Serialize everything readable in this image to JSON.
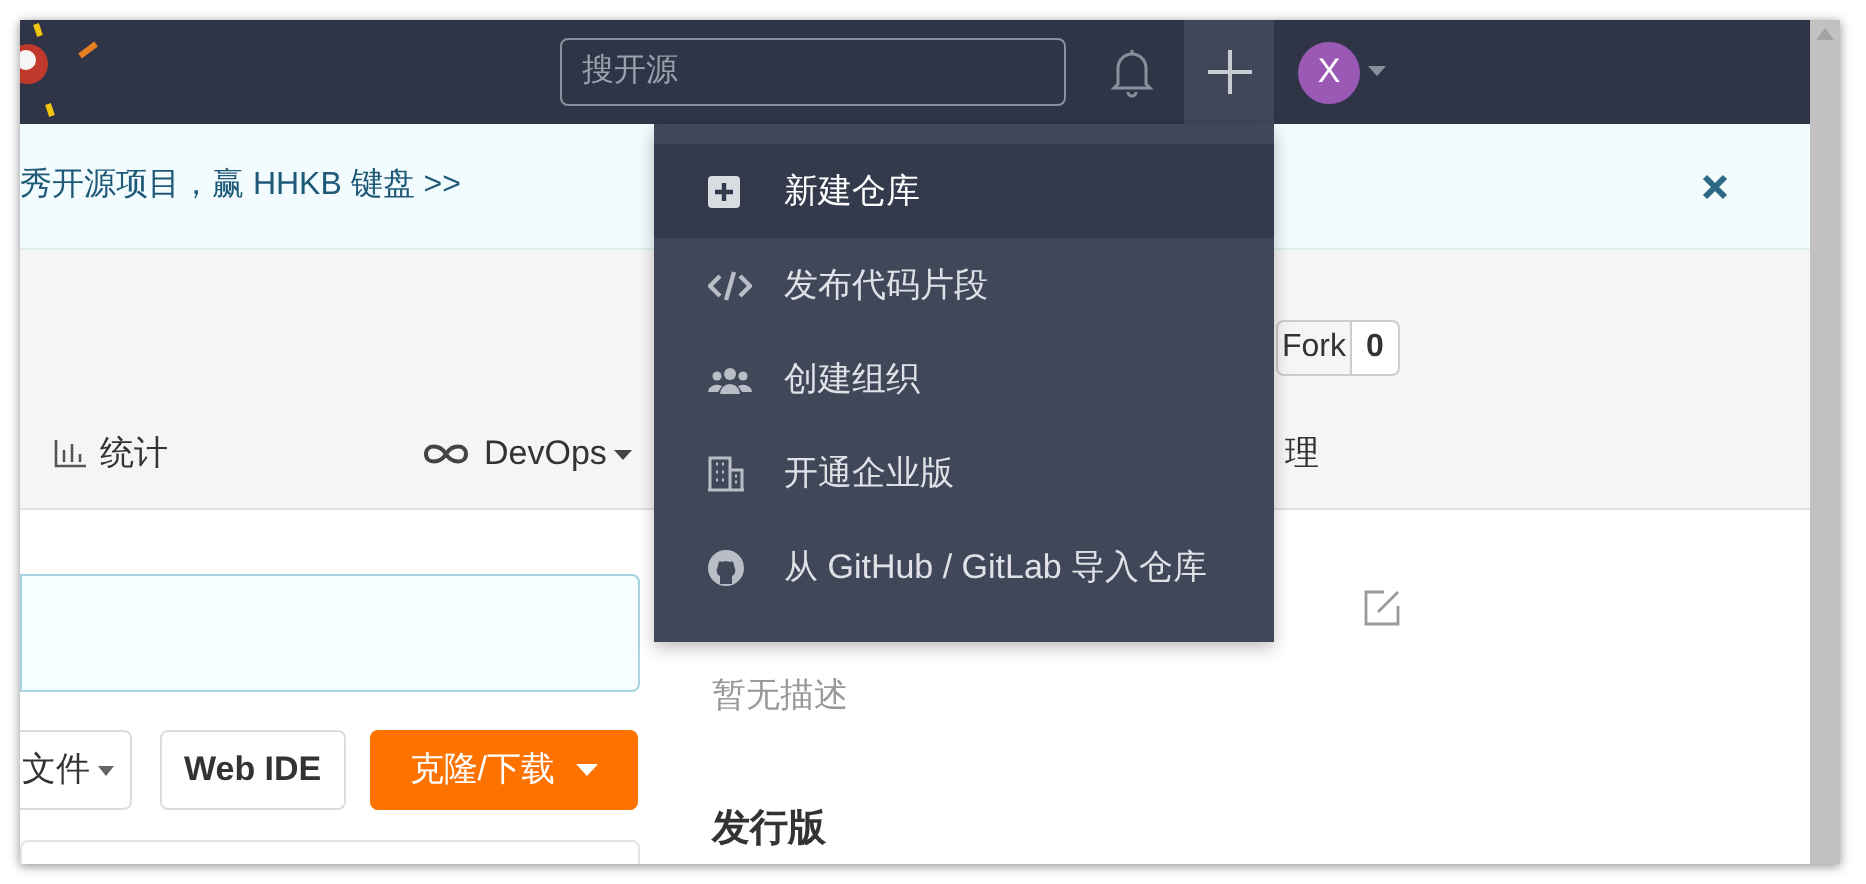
{
  "navbar": {
    "search": {
      "placeholder": "搜开源"
    },
    "avatar": "X"
  },
  "banner": {
    "text": "秀开源项目，赢 HHKB 键盘 >>"
  },
  "fork": {
    "label": "Fork",
    "count": "0"
  },
  "tabs": [
    {
      "kind": "chart",
      "label": "统计",
      "caret": false
    },
    {
      "kind": "infinity",
      "label": "DevOps",
      "caret": true
    },
    {
      "kind": "plain",
      "label": "理",
      "caret": false
    }
  ],
  "toolbar": [
    {
      "kind": "menu",
      "label": "文件"
    },
    {
      "kind": "outline",
      "label": "Web IDE"
    },
    {
      "kind": "primary",
      "label": "克隆/下载"
    }
  ],
  "sidebar": {
    "description": "暂无描述",
    "releases_heading": "发行版"
  },
  "create_menu": [
    {
      "kind": "plus",
      "label": "新建仓库",
      "selected": true
    },
    {
      "kind": "code",
      "label": "发布代码片段",
      "selected": false
    },
    {
      "kind": "users",
      "label": "创建组织",
      "selected": false
    },
    {
      "kind": "building",
      "label": "开通企业版",
      "selected": false
    },
    {
      "kind": "github",
      "label": "从 GitHub / GitLab 导入仓库",
      "selected": false
    }
  ]
}
